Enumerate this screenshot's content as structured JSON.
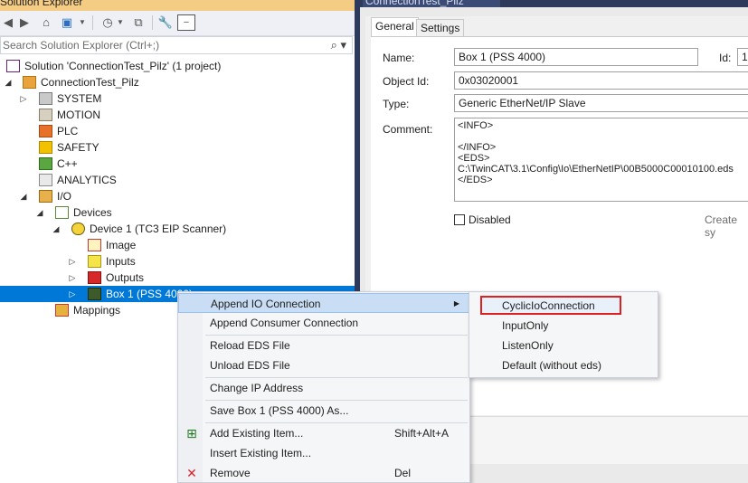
{
  "solution_explorer": {
    "title": "Solution Explorer",
    "search_placeholder": "Search Solution Explorer (Ctrl+;)",
    "tree": [
      {
        "label": "Solution 'ConnectionTest_Pilz' (1 project)",
        "icon": "solution-icon"
      },
      {
        "label": "ConnectionTest_Pilz",
        "icon": "project-icon"
      },
      {
        "label": "SYSTEM",
        "icon": "system-icon"
      },
      {
        "label": "MOTION",
        "icon": "motion-icon"
      },
      {
        "label": "PLC",
        "icon": "plc-icon"
      },
      {
        "label": "SAFETY",
        "icon": "safety-icon"
      },
      {
        "label": "C++",
        "icon": "cpp-icon"
      },
      {
        "label": "ANALYTICS",
        "icon": "analytics-icon"
      },
      {
        "label": "I/O",
        "icon": "io-icon"
      },
      {
        "label": "Devices",
        "icon": "devices-icon"
      },
      {
        "label": "Device 1 (TC3 EIP Scanner)",
        "icon": "device-icon"
      },
      {
        "label": "Image",
        "icon": "image-icon"
      },
      {
        "label": "Inputs",
        "icon": "inputs-icon"
      },
      {
        "label": "Outputs",
        "icon": "outputs-icon"
      },
      {
        "label": "Box 1 (PSS 4000)",
        "icon": "box-icon"
      },
      {
        "label": "Mappings",
        "icon": "mappings-icon"
      }
    ]
  },
  "editor": {
    "document_tab": "ConnectionTest_Pilz",
    "tabs": [
      "General",
      "Settings"
    ],
    "fields": {
      "name_label": "Name:",
      "name_value": "Box 1 (PSS 4000)",
      "id_label": "Id:",
      "id_value": "1",
      "object_id_label": "Object Id:",
      "object_id_value": "0x03020001",
      "type_label": "Type:",
      "type_value": "Generic EtherNet/IP Slave",
      "comment_label": "Comment:",
      "comment_value": "<INFO>\n\n</INFO>\n<EDS>\nC:\\TwinCAT\\3.1\\Config\\Io\\EtherNetIP\\00B5000C00010100.eds\n</EDS>",
      "disabled_label": "Disabled",
      "create_symbols_label": "Create sy"
    }
  },
  "context_menu": {
    "items": [
      {
        "label": "Append IO Connection",
        "shortcut": "",
        "submenu": true
      },
      {
        "label": "Append Consumer Connection",
        "shortcut": ""
      },
      {
        "label": "Reload EDS File",
        "shortcut": ""
      },
      {
        "label": "Unload EDS File",
        "shortcut": ""
      },
      {
        "label": "Change IP Address",
        "shortcut": ""
      },
      {
        "label": "Save Box 1 (PSS 4000) As...",
        "shortcut": ""
      },
      {
        "label": "Add Existing Item...",
        "shortcut": "Shift+Alt+A"
      },
      {
        "label": "Insert Existing Item...",
        "shortcut": ""
      },
      {
        "label": "Remove",
        "shortcut": "Del"
      }
    ]
  },
  "submenu": {
    "items": [
      "CyclicIoConnection",
      "InputOnly",
      "ListenOnly",
      "Default (without eds)"
    ]
  },
  "colors": {
    "selection": "#0078d7",
    "highlight_box": "#e02020",
    "title_bar": "#f5cc84"
  }
}
